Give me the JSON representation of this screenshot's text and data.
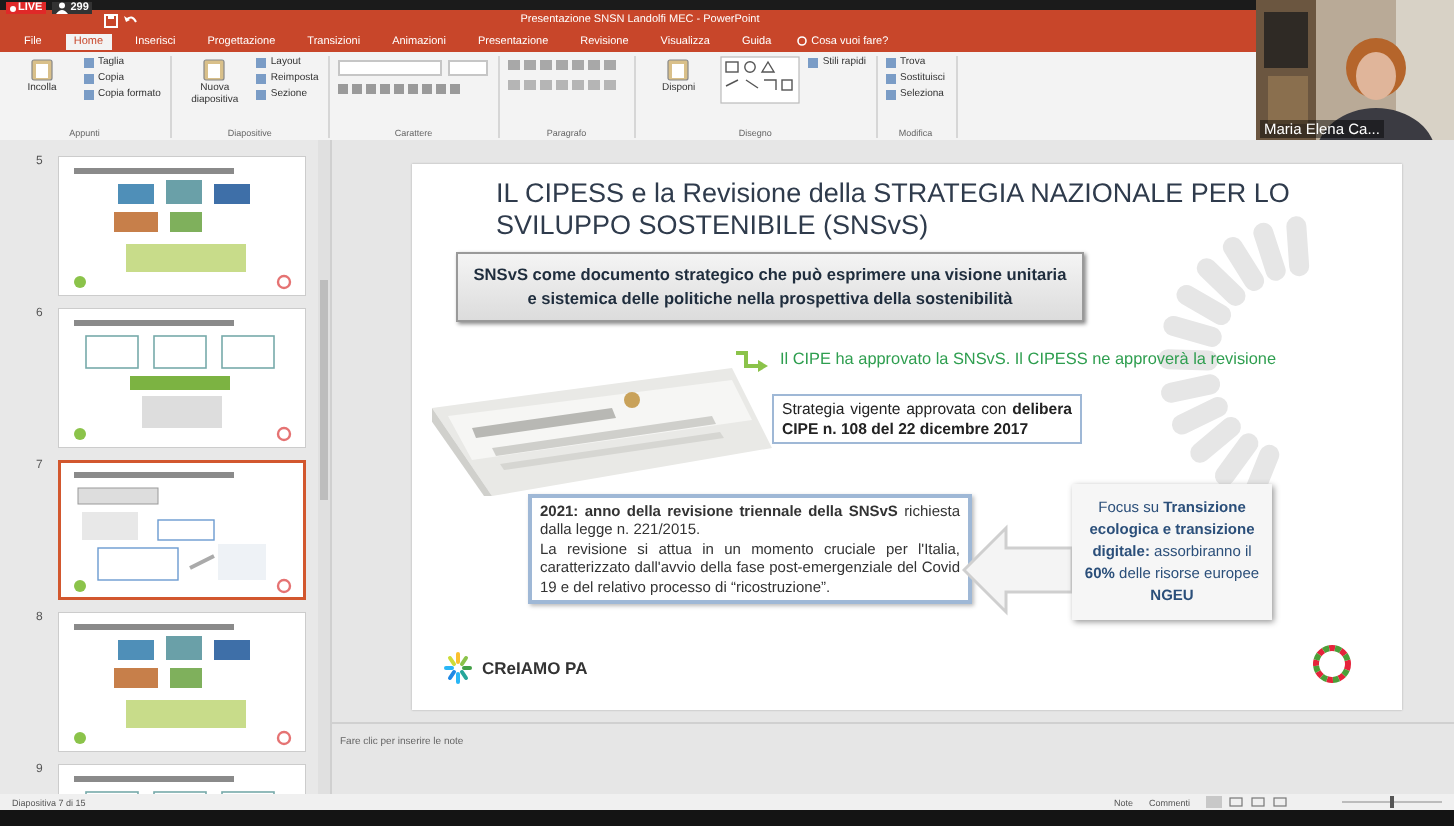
{
  "stream": {
    "live": "LIVE",
    "viewers": "299"
  },
  "window": {
    "title": "Presentazione SNSN Landolfi MEC - PowerPoint"
  },
  "tabs": [
    {
      "label": "File",
      "selected": false
    },
    {
      "label": "Home",
      "selected": true
    },
    {
      "label": "Inserisci",
      "selected": false
    },
    {
      "label": "Progettazione",
      "selected": false
    },
    {
      "label": "Transizioni",
      "selected": false
    },
    {
      "label": "Animazioni",
      "selected": false
    },
    {
      "label": "Presentazione",
      "selected": false
    },
    {
      "label": "Revisione",
      "selected": false
    },
    {
      "label": "Visualizza",
      "selected": false
    },
    {
      "label": "Guida",
      "selected": false
    }
  ],
  "tell_me": "Cosa vuoi fare?",
  "ribbon": {
    "groups": [
      {
        "label": "Appunti",
        "big": "Incolla",
        "items": [
          "Taglia",
          "Copia",
          "Copia formato"
        ]
      },
      {
        "label": "Diapositive",
        "big": "Nuova diapositiva",
        "items": [
          "Layout",
          "Reimposta",
          "Sezione"
        ]
      },
      {
        "label": "Carattere",
        "kind": "font"
      },
      {
        "label": "Paragrafo",
        "kind": "paragraph"
      },
      {
        "label": "Disegno",
        "kind": "drawing",
        "big": "Disponi",
        "items": [
          "Stili rapidi"
        ]
      },
      {
        "label": "Modifica",
        "items": [
          "Trova",
          "Sostituisci",
          "Seleziona"
        ]
      }
    ]
  },
  "video": {
    "name": "Maria Elena Ca..."
  },
  "thumbnails": [
    {
      "number": "5",
      "selected": false
    },
    {
      "number": "6",
      "selected": false
    },
    {
      "number": "7",
      "selected": true
    },
    {
      "number": "8",
      "selected": false
    },
    {
      "number": "9",
      "selected": false
    }
  ],
  "slide": {
    "title": "IL CIPESS e la Revisione della STRATEGIA NAZIONALE PER LO SVILUPPO SOSTENIBILE (SNSvS)",
    "box": "SNSvS come documento strategico che può esprimere una visione unitaria e sistemica delle politiche nella prospettiva della sostenibilità",
    "green_note": "Il CIPE ha approvato la SNSvS. Il CIPESS ne approverà la revisione",
    "strategy": "Strategia vigente approvata con **delibera CIPE n. 108 del 22 dicembre 2017**",
    "revision": [
      "**2021: anno della revisione triennale della SNSvS** richiesta dalla legge n. 221/2015.",
      "La revisione si attua in un momento cruciale per l'Italia, caratterizzato dall'avvio della fase post-emergenziale del Covid 19 e del relativo processo di “ricostruzione”."
    ],
    "focus": "Focus su **Transizione ecologica e transizione digitale:** assorbiranno il **60%** delle risorse europee **NGEU**",
    "logo": "CReIAMO PA"
  },
  "notes": {
    "placeholder": "Fare clic per inserire le note"
  },
  "status_bar": {
    "slide": "Diapositiva 7 di 15",
    "notes": "Note",
    "comments": "Commenti",
    "zoom": {
      "level": 0.5
    }
  }
}
